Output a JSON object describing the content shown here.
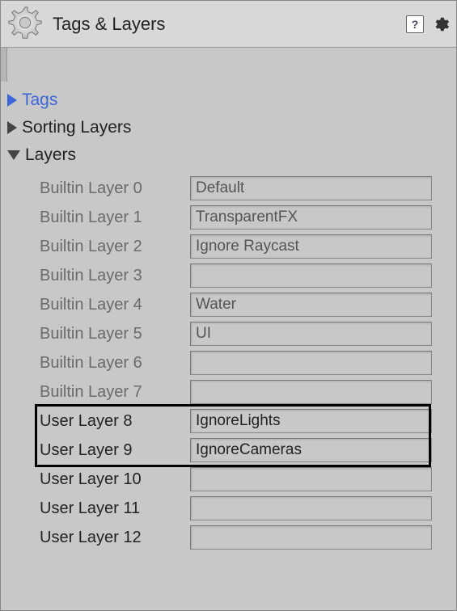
{
  "header": {
    "title": "Tags & Layers"
  },
  "sections": {
    "tags": {
      "label": "Tags",
      "expanded": false,
      "highlighted": true
    },
    "sortingLayers": {
      "label": "Sorting Layers",
      "expanded": false
    },
    "layers": {
      "label": "Layers",
      "expanded": true
    }
  },
  "layers": [
    {
      "label": "Builtin Layer 0",
      "value": "Default",
      "editable": false
    },
    {
      "label": "Builtin Layer 1",
      "value": "TransparentFX",
      "editable": false
    },
    {
      "label": "Builtin Layer 2",
      "value": "Ignore Raycast",
      "editable": false
    },
    {
      "label": "Builtin Layer 3",
      "value": "",
      "editable": false
    },
    {
      "label": "Builtin Layer 4",
      "value": "Water",
      "editable": false
    },
    {
      "label": "Builtin Layer 5",
      "value": "UI",
      "editable": false
    },
    {
      "label": "Builtin Layer 6",
      "value": "",
      "editable": false
    },
    {
      "label": "Builtin Layer 7",
      "value": "",
      "editable": false
    },
    {
      "label": "User Layer 8",
      "value": "IgnoreLights",
      "editable": true
    },
    {
      "label": "User Layer 9",
      "value": "IgnoreCameras",
      "editable": true
    },
    {
      "label": "User Layer 10",
      "value": "",
      "editable": true
    },
    {
      "label": "User Layer 11",
      "value": "",
      "editable": true
    },
    {
      "label": "User Layer 12",
      "value": "",
      "editable": true
    }
  ],
  "highlight": {
    "startIndex": 8,
    "endIndex": 9
  }
}
